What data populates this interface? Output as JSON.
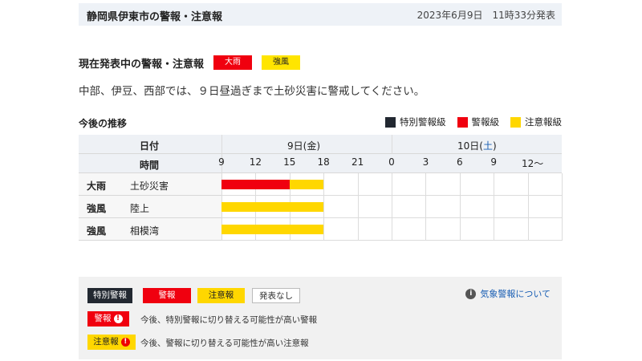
{
  "header": {
    "title": "静岡県伊東市の警報・注意報",
    "issued": "2023年6月9日　11時33分発表"
  },
  "current": {
    "label": "現在発表中の警報・注意報",
    "badges": [
      {
        "label": "大雨",
        "level": "warning"
      },
      {
        "label": "強風",
        "level": "advisory"
      }
    ]
  },
  "message": "中部、伊豆、西部では、９日昼過ぎまで土砂災害に警戒してください。",
  "trend": {
    "title": "今後の推移",
    "legend": [
      "特別警報級",
      "警報級",
      "注意報級"
    ],
    "date_label": "日付",
    "time_label": "時間",
    "date_groups": [
      {
        "label": "9日(金)"
      },
      {
        "label_prefix": "10日(",
        "label_day": "土",
        "label_suffix": ")",
        "day_color": "#1a5fb4"
      }
    ],
    "time_ticks": [
      "9",
      "12",
      "15",
      "18",
      "21",
      "0",
      "3",
      "6",
      "9",
      "12〜"
    ],
    "rows": [
      {
        "type": "大雨",
        "area": "土砂災害",
        "segments": [
          {
            "from_slot": 0,
            "to_slot": 2,
            "level": "warning"
          },
          {
            "from_slot": 2,
            "to_slot": 3,
            "level": "advisory"
          }
        ]
      },
      {
        "type": "強風",
        "area": "陸上",
        "segments": [
          {
            "from_slot": 0,
            "to_slot": 3,
            "level": "advisory"
          }
        ]
      },
      {
        "type": "強風",
        "area": "相模湾",
        "segments": [
          {
            "from_slot": 0,
            "to_slot": 3,
            "level": "advisory"
          }
        ]
      }
    ],
    "colors": {
      "special": "#222831",
      "warning": "#f0000f",
      "advisory": "#ffd700"
    }
  },
  "legend_box": {
    "badges": [
      "特別警報",
      "警報",
      "注意報",
      "発表なし"
    ],
    "info_link": "気象警報について",
    "notes": [
      {
        "badge": "警報",
        "text": "今後、特別警報に切り替える可能性が高い警報"
      },
      {
        "badge": "注意報",
        "text": "今後、警報に切り替える可能性が高い注意報"
      }
    ]
  }
}
